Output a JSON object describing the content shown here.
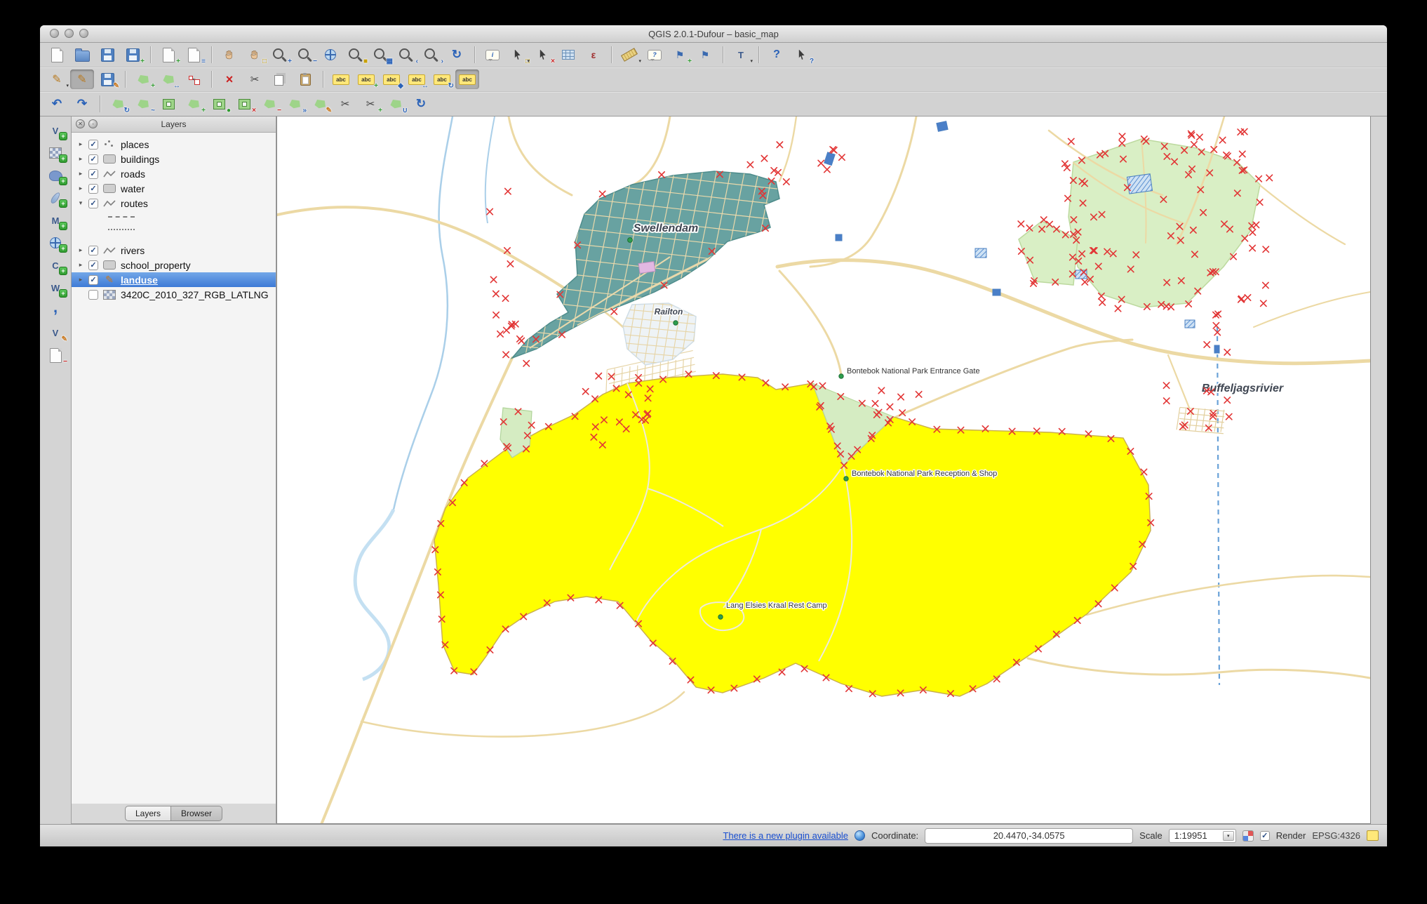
{
  "window": {
    "title": "QGIS 2.0.1-Dufour – basic_map"
  },
  "panels": {
    "layers": {
      "title": "Layers",
      "tabs": [
        {
          "label": "Layers",
          "active": true
        },
        {
          "label": "Browser",
          "active": false
        }
      ]
    }
  },
  "layers": [
    {
      "label": "places",
      "checked": true,
      "arrow": "right",
      "icon": "points"
    },
    {
      "label": "buildings",
      "checked": true,
      "arrow": "right",
      "icon": "polygon"
    },
    {
      "label": "roads",
      "checked": true,
      "arrow": "right",
      "icon": "line"
    },
    {
      "label": "water",
      "checked": true,
      "arrow": "right",
      "icon": "polygon"
    },
    {
      "label": "routes",
      "checked": true,
      "arrow": "down",
      "icon": "line",
      "children": [
        {
          "swatch": "dashed"
        },
        {
          "swatch": "dotted"
        }
      ]
    },
    {
      "label": "rivers",
      "checked": true,
      "arrow": "right",
      "icon": "line"
    },
    {
      "label": "school_property",
      "checked": true,
      "arrow": "right",
      "icon": "polygon"
    },
    {
      "label": "landuse",
      "checked": true,
      "arrow": "right",
      "icon": "pencil",
      "selected": true
    },
    {
      "label": "3420C_2010_327_RGB_LATLNG",
      "checked": false,
      "arrow": "none",
      "icon": "raster"
    }
  ],
  "toolbars": {
    "main": [
      {
        "name": "new-project",
        "base": "page"
      },
      {
        "name": "open-project",
        "base": "folder"
      },
      {
        "name": "save-project",
        "base": "floppy"
      },
      {
        "name": "save-project-as",
        "base": "floppy",
        "ov": "+",
        "ovc": "green"
      },
      {
        "sep": true
      },
      {
        "name": "new-print-composer",
        "base": "page",
        "ov": "+",
        "ovc": "green"
      },
      {
        "name": "composer-manager",
        "base": "page",
        "ov": "≡",
        "ovc": "blue"
      },
      {
        "sep": true
      },
      {
        "name": "pan-map",
        "base": "hand"
      },
      {
        "name": "pan-to-selection",
        "base": "hand",
        "ov": "□",
        "ovc": "yellow"
      },
      {
        "name": "zoom-in",
        "base": "mag",
        "ov": "+",
        "ovc": "blue"
      },
      {
        "name": "zoom-out",
        "base": "mag",
        "ov": "−",
        "ovc": "blue"
      },
      {
        "name": "zoom-full-extent",
        "base": "globe"
      },
      {
        "name": "zoom-to-selection",
        "base": "mag",
        "ov": "■",
        "ovc": "yellow"
      },
      {
        "name": "zoom-to-layer",
        "base": "mag",
        "ov": "▦",
        "ovc": "blue"
      },
      {
        "name": "zoom-last",
        "base": "mag",
        "ov": "‹",
        "ovc": "blue"
      },
      {
        "name": "zoom-next",
        "base": "mag",
        "ov": "›",
        "ovc": "blue"
      },
      {
        "name": "map-refresh",
        "base": "refresh",
        "txt": "↻"
      },
      {
        "sep": true
      },
      {
        "name": "identify-features",
        "base": "bubble",
        "txt": "i"
      },
      {
        "name": "select-features",
        "base": "cursor",
        "ov": "□",
        "ovc": "yellow",
        "dd": true
      },
      {
        "name": "deselect-features",
        "base": "cursor",
        "ov": "×",
        "ovc": "red"
      },
      {
        "name": "open-attribute-table",
        "base": "table"
      },
      {
        "name": "field-calculator",
        "base": "eps",
        "txt": "ε"
      },
      {
        "sep": true
      },
      {
        "name": "measure-line",
        "base": "ruler",
        "dd": true
      },
      {
        "name": "map-tips",
        "base": "bubble",
        "txt": "?"
      },
      {
        "name": "new-bookmark",
        "base": "flag",
        "txt": "⚑",
        "ov": "+",
        "ovc": "green"
      },
      {
        "name": "show-bookmarks",
        "base": "flag",
        "txt": "⚑"
      },
      {
        "sep": true
      },
      {
        "name": "text-annotation",
        "base": "letter",
        "txt": "T",
        "dd": true
      },
      {
        "sep": true
      },
      {
        "name": "help-contents",
        "base": "q",
        "txt": "?"
      },
      {
        "name": "whats-this",
        "base": "cursor",
        "ov": "?",
        "ovc": "blue"
      }
    ],
    "digitizing": [
      {
        "name": "current-edits",
        "base": "pencil",
        "txt": "✎",
        "dd": true
      },
      {
        "name": "toggle-editing",
        "base": "pencil",
        "txt": "✎",
        "pressed": true
      },
      {
        "name": "save-layer-edits",
        "base": "floppy",
        "ov": "✎",
        "ovc": "orange"
      },
      {
        "sep": true
      },
      {
        "name": "add-feature",
        "base": "poly",
        "ov": "+",
        "ovc": "green"
      },
      {
        "name": "move-feature",
        "base": "poly",
        "ov": "↔",
        "ovc": "blue"
      },
      {
        "name": "node-tool",
        "base": "node"
      },
      {
        "sep": true
      },
      {
        "name": "delete-selected",
        "base": "x",
        "txt": "×"
      },
      {
        "name": "cut-features",
        "base": "scissors",
        "txt": "✂"
      },
      {
        "name": "copy-features",
        "base": "copy"
      },
      {
        "name": "paste-features",
        "base": "paste"
      },
      {
        "sep": true
      },
      {
        "name": "labeling",
        "base": "abc",
        "txt": "abc"
      },
      {
        "name": "label-add",
        "base": "abc",
        "txt": "abc",
        "ov": "+",
        "ovc": "green"
      },
      {
        "name": "label-pin",
        "base": "abc",
        "txt": "abc",
        "ov": "◆",
        "ovc": "blue"
      },
      {
        "name": "label-move",
        "base": "abc",
        "txt": "abc",
        "ov": "↔",
        "ovc": "blue"
      },
      {
        "name": "label-rotate",
        "base": "abc",
        "txt": "abc",
        "ov": "↻",
        "ovc": "blue"
      },
      {
        "name": "label-properties",
        "base": "abc",
        "txt": "abc",
        "pressed": true
      }
    ],
    "advanced": [
      {
        "name": "undo",
        "base": "undo",
        "txt": "↶"
      },
      {
        "name": "redo",
        "base": "redo",
        "txt": "↷"
      },
      {
        "sep": true
      },
      {
        "name": "rotate-feature",
        "base": "poly",
        "ov": "↻",
        "ovc": "blue"
      },
      {
        "name": "simplify-feature",
        "base": "poly",
        "ov": "~",
        "ovc": "blue"
      },
      {
        "name": "add-ring",
        "base": "ring"
      },
      {
        "name": "add-part",
        "base": "poly",
        "ov": "+",
        "ovc": "green"
      },
      {
        "name": "fill-ring",
        "base": "ring",
        "ov": "●",
        "ovc": "green"
      },
      {
        "name": "delete-ring",
        "base": "ring",
        "ov": "×",
        "ovc": "red"
      },
      {
        "name": "delete-part",
        "base": "poly",
        "ov": "−",
        "ovc": "red"
      },
      {
        "name": "offset-curve",
        "base": "poly",
        "ov": "»",
        "ovc": "blue"
      },
      {
        "name": "reshape-features",
        "base": "poly",
        "ov": "✎",
        "ovc": "orange"
      },
      {
        "name": "split-features",
        "base": "scissors",
        "txt": "✂"
      },
      {
        "name": "split-parts",
        "base": "scissors",
        "txt": "✂",
        "ov": "+",
        "ovc": "green"
      },
      {
        "name": "merge-features",
        "base": "poly",
        "ov": "∪",
        "ovc": "blue"
      },
      {
        "name": "rotate-point-symbols",
        "base": "refresh",
        "txt": "↻"
      }
    ],
    "manage_layers": [
      {
        "name": "add-vector-layer",
        "base": "letter",
        "txt": "V",
        "badge": "+"
      },
      {
        "name": "add-raster-layer",
        "base": "raster",
        "badge": "+"
      },
      {
        "name": "add-postgis-layer",
        "base": "elephant",
        "badge": "+"
      },
      {
        "name": "add-spatialite-layer",
        "base": "feather",
        "badge": "+"
      },
      {
        "name": "add-mssql-layer",
        "base": "letter",
        "txt": "M",
        "badge": "+"
      },
      {
        "name": "add-wms-layer",
        "base": "globe",
        "badge": "+"
      },
      {
        "name": "add-wcs-layer",
        "base": "letter",
        "txt": "C",
        "badge": "+"
      },
      {
        "name": "add-wfs-layer",
        "base": "letter",
        "txt": "W",
        "badge": "+"
      },
      {
        "name": "add-delimited-text-layer",
        "base": "comma",
        "txt": ","
      },
      {
        "name": "new-shapefile-layer",
        "base": "letter",
        "txt": "V",
        "ov": "✎",
        "ovc": "orange"
      },
      {
        "name": "remove-layer",
        "base": "page",
        "ov": "−",
        "ovc": "red"
      }
    ]
  },
  "map": {
    "labels": {
      "town": "Swellendam",
      "suburb": "Railton",
      "gate": "Bontebok National Park Entrance Gate",
      "reception": "Bontebok National Park Reception & Shop",
      "camp": "Lang Elsies Kraal Rest Camp",
      "river": "Buffeljagsrivier"
    }
  },
  "status_bar": {
    "plugin_link": "There is a new plugin available",
    "coordinate_label": "Coordinate:",
    "coordinate_value": "20.4470,-34.0575",
    "scale_label": "Scale",
    "scale_value": "1:19951",
    "render_label": "Render",
    "crs": "EPSG:4326"
  },
  "colors": {
    "selection_yellow": "#ffff00",
    "town_fill": "#68a2a1",
    "park_green": "#d9efc5",
    "road": "#ecd9a4",
    "water": "#a9cfe8",
    "vertex_marker": "#e23535"
  }
}
